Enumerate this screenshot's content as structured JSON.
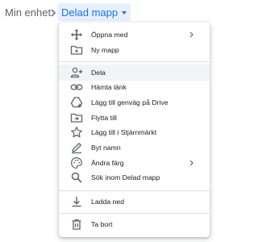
{
  "breadcrumb": {
    "root_label": "Min enhet",
    "current_label": "Delad mapp"
  },
  "menu": {
    "items": [
      {
        "label": "Öppna med",
        "icon": "move-arrows-icon",
        "submenu": true
      },
      {
        "label": "Ny mapp",
        "icon": "new-folder-icon"
      },
      {
        "label": "Dela",
        "icon": "person-add-icon",
        "highlighted": true
      },
      {
        "label": "Hämta länk",
        "icon": "link-icon"
      },
      {
        "label": "Lägg till genväg på Drive",
        "icon": "drive-shortcut-icon"
      },
      {
        "label": "Flytta till",
        "icon": "move-to-folder-icon"
      },
      {
        "label": "Lägg till i Stjärnmärkt",
        "icon": "star-icon"
      },
      {
        "label": "Byt namn",
        "icon": "pencil-icon"
      },
      {
        "label": "Ändra färg",
        "icon": "palette-icon",
        "submenu": true
      },
      {
        "label": "Sök inom Delad mapp",
        "icon": "search-icon"
      },
      {
        "label": "Ladda ned",
        "icon": "download-icon"
      },
      {
        "label": "Ta bort",
        "icon": "trash-icon"
      }
    ]
  },
  "colors": {
    "accent": "#1a73e8",
    "accent_bg": "#e8f0fe",
    "icon": "#5f6368",
    "text": "#202124",
    "highlight": "#f1f3f4"
  }
}
